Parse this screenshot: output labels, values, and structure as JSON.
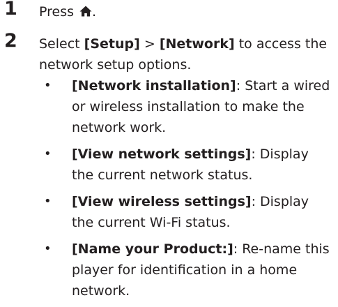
{
  "steps": [
    {
      "number": "1",
      "text_before": "Press ",
      "icon": "home-icon",
      "text_after": "."
    },
    {
      "number": "2",
      "text_parts": {
        "p1": "Select ",
        "setup": "[Setup]",
        "p2": " > ",
        "network": "[Network]",
        "p3": " to access the network setup options."
      }
    }
  ],
  "bullets": [
    {
      "label": "[Network installation]",
      "text": ": Start a wired or wireless installation to make the network work."
    },
    {
      "label": "[View network settings]",
      "text": ": Display the current network status."
    },
    {
      "label": "[View wireless settings]",
      "text": ": Display the current Wi-Fi status."
    },
    {
      "label": "[Name your Product:]",
      "text": ": Re-name this player for identification in a home network."
    }
  ],
  "bullet_char": "•",
  "colors": {
    "text": "#231f20",
    "background": "#ffffff"
  }
}
